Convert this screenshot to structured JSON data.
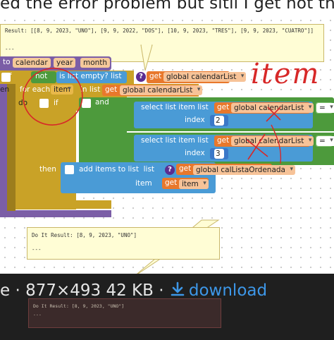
{
  "post_title_fragment": "ed the error problem but sitll I get not th",
  "top_balloon": {
    "result": "Result: [[8, 9, 2023, \"UNO\"], [9, 9, 2022, \"DOS\"], [10, 9, 2023, \"TRES\"], [9, 9, 2023, \"CUATRO\"]]",
    "tail": "---"
  },
  "procedure": {
    "keyword": "to",
    "name": "calendar",
    "param1": "year",
    "param2": "month"
  },
  "if_block": {
    "if_kw": "if",
    "not_kw": "not",
    "is_empty_kw": "is list empty?",
    "list_kw": "list",
    "get_kw": "get",
    "var": "global calendarList"
  },
  "side_labels": {
    "then": "en",
    "do": "do"
  },
  "foreach": {
    "label": "for each",
    "item_var": "item",
    "in_list_kw": "in list",
    "get_kw": "get",
    "var": "global calendarList"
  },
  "inner_if": {
    "if_kw": "if",
    "and_kw": "and",
    "then_kw": "then"
  },
  "select1": {
    "label": "select list item",
    "list_kw": "list",
    "get_kw": "get",
    "var": "global calendarList",
    "index_kw": "index",
    "index": "2",
    "op": "="
  },
  "select2": {
    "label": "select list item",
    "list_kw": "list",
    "get_kw": "get",
    "var": "global calendarList",
    "index_kw": "index",
    "index": "3",
    "op": "="
  },
  "add_items": {
    "label": "add items to list",
    "list_kw": "list",
    "get_kw": "get",
    "var": "global calListaOrdenada",
    "item_kw": "item",
    "item_get": "get",
    "item_var": "item"
  },
  "annotation": "item",
  "bottom_balloon": {
    "result": "Do It Result: [8, 9, 2023, \"UNO\"]",
    "tail": "---"
  },
  "image_info": {
    "prefix": "e · ",
    "dims": "877×493",
    "size": "42 KB",
    "sep": "·",
    "download": "download"
  },
  "thumb_balloon": {
    "result": "Do It Result: [8, 9, 2023, \"UNO\"]",
    "tail": "---"
  },
  "colors": {
    "procedure": "#7b5ea6",
    "control": "#c9a227",
    "control_dark": "#9c7d1d",
    "logic": "#4d9a3c",
    "lists": "#4a9bd6",
    "variables": "#e8782c",
    "math": "#3a78c8",
    "annotation_red": "#d72828"
  }
}
